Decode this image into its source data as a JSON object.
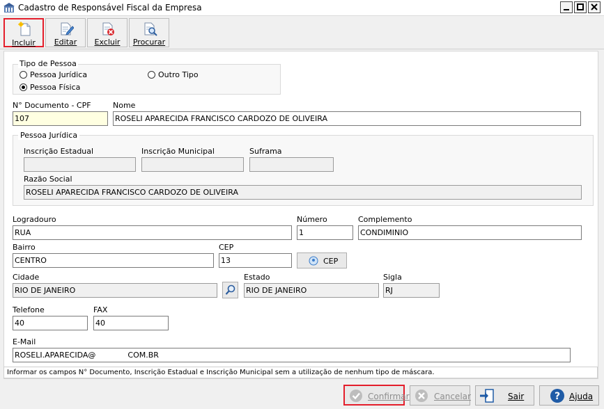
{
  "window": {
    "title": "Cadastro de Responsável Fiscal da Empresa"
  },
  "toolbar": {
    "incluir": "Incluir",
    "editar": "Editar",
    "excluir": "Excluir",
    "procurar": "Procurar"
  },
  "tipo_pessoa": {
    "legend": "Tipo de Pessoa",
    "juridica": "Pessoa Jurídica",
    "fisica": "Pessoa Física",
    "outro": "Outro Tipo",
    "selected": "Pessoa Física"
  },
  "documento": {
    "label": "N° Documento - CPF",
    "value": "107"
  },
  "nome": {
    "label": "Nome",
    "value": "ROSELI APARECIDA FRANCISCO CARDOZO DE OLIVEIRA"
  },
  "pessoa_juridica": {
    "legend": "Pessoa Jurídica",
    "inscricao_estadual": {
      "label": "Inscrição Estadual",
      "value": ""
    },
    "inscricao_municipal": {
      "label": "Inscrição Municipal",
      "value": ""
    },
    "suframa": {
      "label": "Suframa",
      "value": ""
    },
    "razao_social": {
      "label": "Razão Social",
      "value": "ROSELI APARECIDA FRANCISCO CARDOZO DE OLIVEIRA"
    }
  },
  "logradouro": {
    "label": "Logradouro",
    "value": "RUA"
  },
  "numero": {
    "label": "Número",
    "value": "1"
  },
  "complemento": {
    "label": "Complemento",
    "value": "CONDIMINIO"
  },
  "bairro": {
    "label": "Bairro",
    "value": "CENTRO"
  },
  "cep": {
    "label": "CEP",
    "value": "13",
    "button": "CEP"
  },
  "cidade": {
    "label": "Cidade",
    "value": "RIO DE JANEIRO"
  },
  "estado": {
    "label": "Estado",
    "value": "RIO DE JANEIRO"
  },
  "sigla": {
    "label": "Sigla",
    "value": "RJ"
  },
  "telefone": {
    "label": "Telefone",
    "value": "40"
  },
  "fax": {
    "label": "FAX",
    "value": "40"
  },
  "email": {
    "label": "E-Mail",
    "value_prefix": "ROSELI.APARECIDA@",
    "value_suffix": "COM.BR"
  },
  "status": "Informar os campos N° Documento, Inscrição Estadual e Inscrição Municipal sem a utilização de nenhum tipo de máscara.",
  "buttons": {
    "confirmar": "Confirmar",
    "cancelar": "Cancelar",
    "sair": "Sair",
    "ajuda": "Ajuda"
  },
  "colors": {
    "highlight": "#e41e2b",
    "help_blue": "#1f5ba6",
    "exit_blue": "#1f5ba6"
  }
}
